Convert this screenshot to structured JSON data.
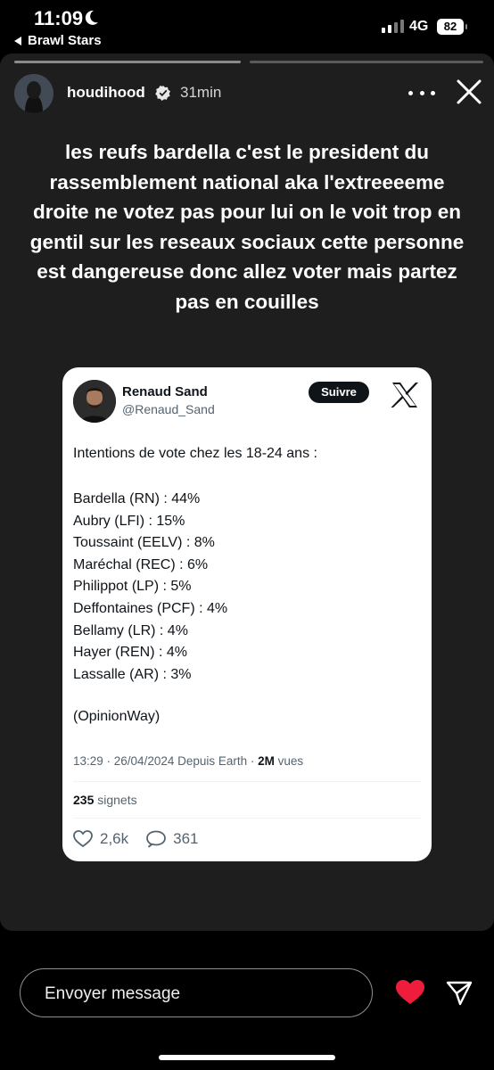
{
  "status_bar": {
    "time": "11:09",
    "back_app": "Brawl Stars",
    "network": "4G",
    "battery": "82"
  },
  "story": {
    "username": "houdihood",
    "posted": "31min",
    "caption": "les reufs bardella c'est le president du rassemblement national aka l'extreeeeme droite ne votez pas pour lui on le voit trop en gentil sur les reseaux sociaux cette personne est dangereuse donc allez voter mais partez pas en couilles",
    "progress_bars": 2,
    "icons": [
      "verified-icon",
      "more-icon",
      "close-icon"
    ]
  },
  "tweet": {
    "author_name": "Renaud Sand",
    "author_handle": "@Renaud_Sand",
    "follow_label": "Suivre",
    "intro": "Intentions de vote chez les 18-24 ans :",
    "results": [
      "Bardella (RN) : 44%",
      "Aubry (LFI) : 15%",
      "Toussaint (EELV) : 8%",
      "Maréchal (REC) : 6%",
      "Philippot (LP) : 5%",
      "Deffontaines (PCF) : 4%",
      "Bellamy (LR) : 4%",
      "Hayer (REN) : 4%",
      "Lassalle (AR) : 3%"
    ],
    "source": "(OpinionWay)",
    "meta_prefix": "13:29 · 26/04/2024 Depuis Earth · ",
    "views_count": "2M",
    "views_label": " vues",
    "bookmarks_count": "235",
    "bookmarks_label": " signets",
    "likes": "2,6k",
    "replies": "361"
  },
  "composer": {
    "placeholder": "Envoyer message"
  },
  "colors": {
    "story_bg": "#1e1e1e",
    "like_red": "#ed1d3b",
    "tweet_text": "#0f1419",
    "tweet_muted": "#536471"
  }
}
